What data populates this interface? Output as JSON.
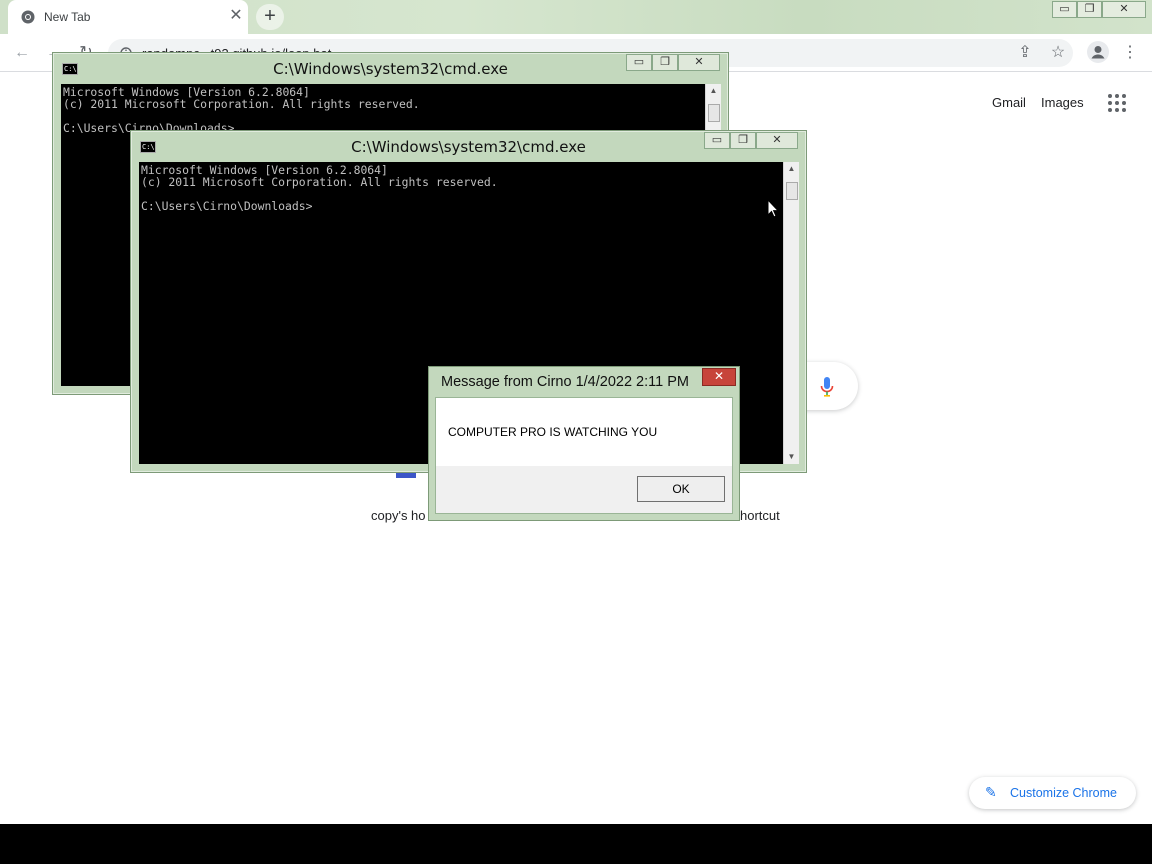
{
  "chrome": {
    "tab_title": "New Tab",
    "tab_close": "✕",
    "new_tab": "+",
    "url": "randompc...t93.github.io/loop.bat",
    "back": "←",
    "forward": "→",
    "reload": "↻",
    "share": "⇪",
    "star": "☆",
    "menu": "⋮",
    "window_minimize": "▭",
    "window_restore": "❐",
    "window_close": "✕"
  },
  "ntp": {
    "gmail": "Gmail",
    "images": "Images",
    "shortcut_fragment_left": "copy's ho",
    "shortcut_fragment_right": "hortcut",
    "customize_label": "Customize Chrome",
    "colors": {
      "accent": "#1a73e8"
    }
  },
  "cmd_back": {
    "title": "C:\\Windows\\system32\\cmd.exe",
    "icon": "C:\\",
    "lines": "Microsoft Windows [Version 6.2.8064]\n(c) 2011 Microsoft Corporation. All rights reserved.\n\nC:\\Users\\Cirno\\Downloads>",
    "btn_min": "▭",
    "btn_max": "❐",
    "btn_close": "✕"
  },
  "cmd_front": {
    "title": "C:\\Windows\\system32\\cmd.exe",
    "icon": "C:\\",
    "lines": "Microsoft Windows [Version 6.2.8064]\n(c) 2011 Microsoft Corporation. All rights reserved.\n\nC:\\Users\\Cirno\\Downloads>",
    "btn_min": "▭",
    "btn_max": "❐",
    "btn_close": "✕"
  },
  "msgbox": {
    "title": "Message from Cirno 1/4/2022 2:11 PM",
    "close": "✕",
    "message": "COMPUTER PRO IS WATCHING YOU",
    "ok": "OK"
  }
}
